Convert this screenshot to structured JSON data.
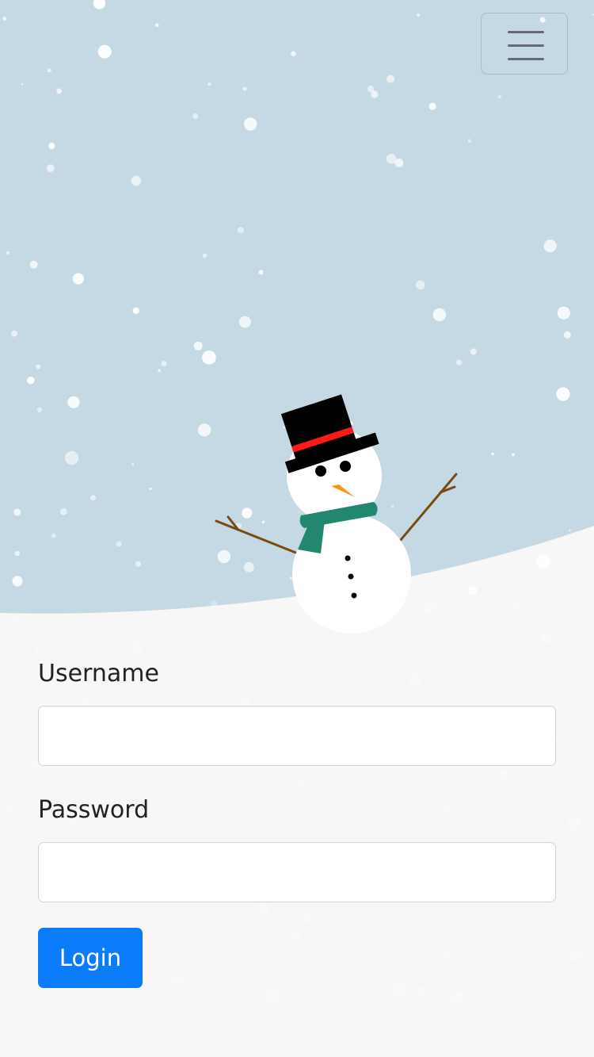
{
  "scene": {
    "sky_color": "#c5d9e4",
    "snow_ground_color": "#f8f7f7",
    "snowman": {
      "hat_color": "#000000",
      "hat_band_color": "#ff1a1a",
      "nose_color": "#f7941d",
      "scarf_color": "#23876f",
      "arm_color": "#7a4a12"
    }
  },
  "nav": {
    "menu_icon": "hamburger-menu-icon"
  },
  "form": {
    "username_label": "Username",
    "username_value": "",
    "password_label": "Password",
    "password_value": "",
    "login_label": "Login"
  },
  "colors": {
    "primary": "#0a7bfb"
  }
}
